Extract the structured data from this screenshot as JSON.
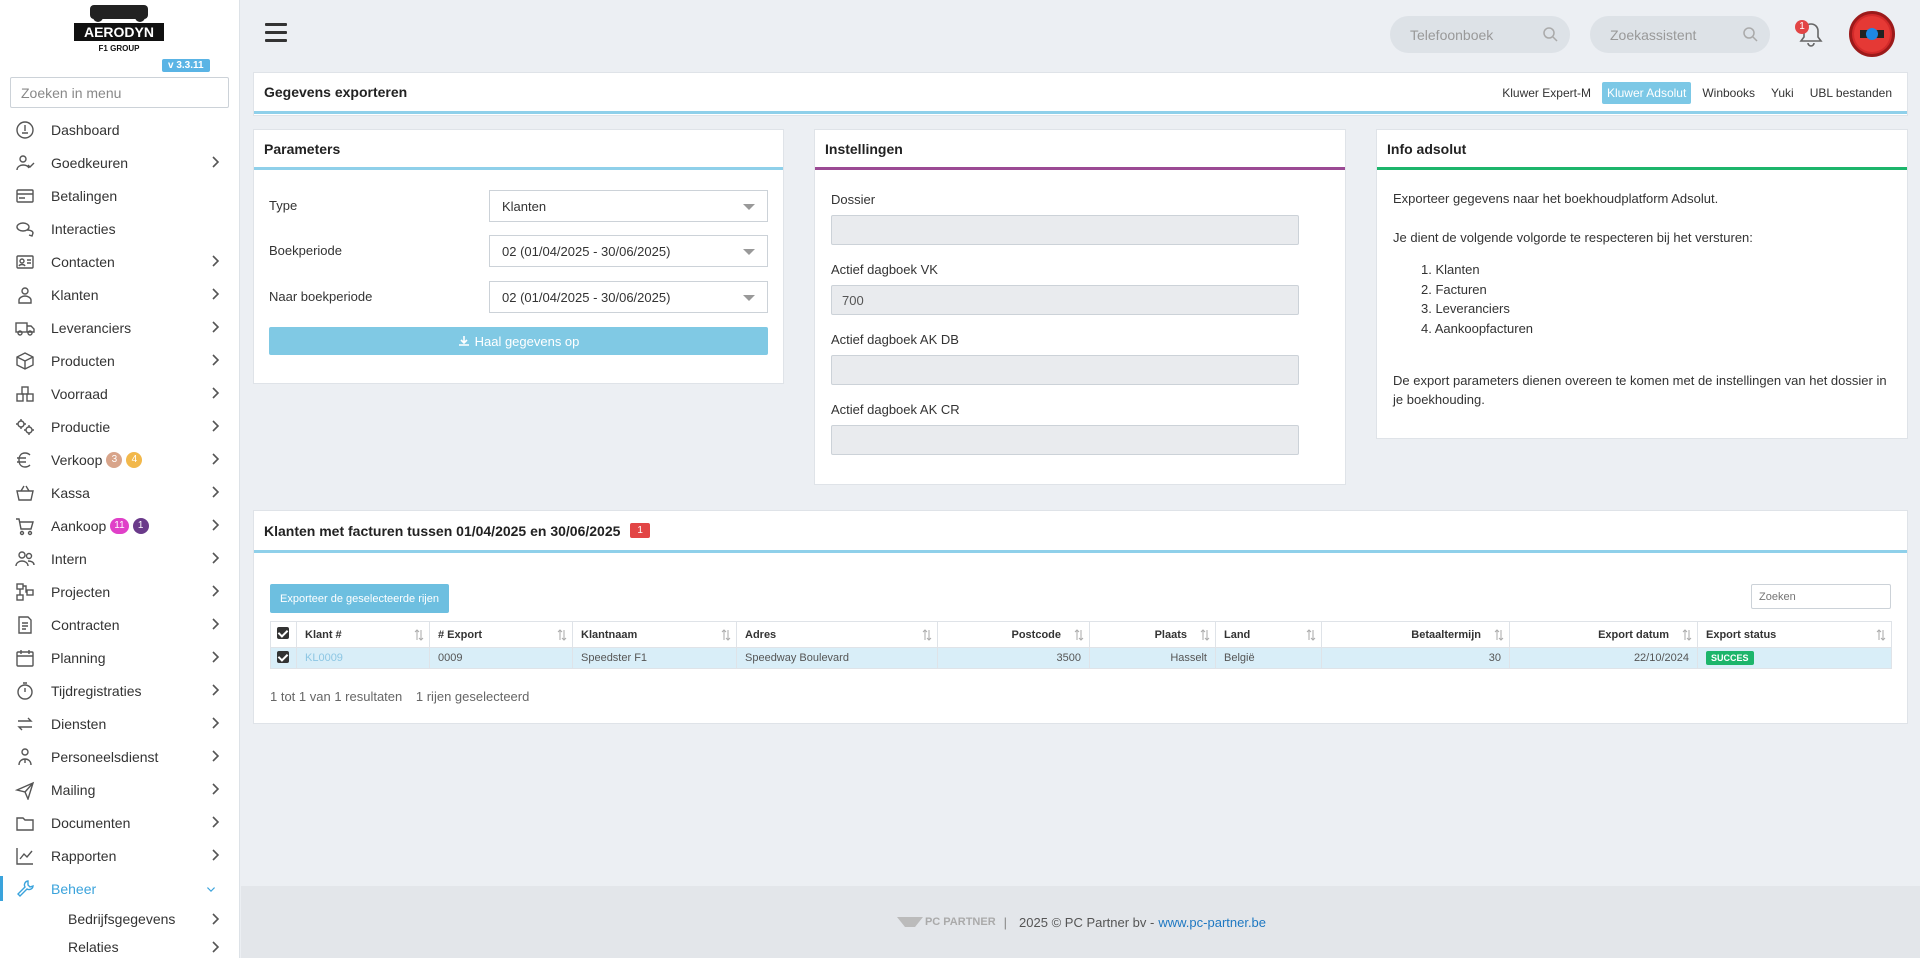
{
  "sidebar": {
    "logo_text": "AERODYN",
    "logo_sub": "F1 GROUP",
    "version": "v 3.3.11",
    "search_placeholder": "Zoeken in menu",
    "items": [
      {
        "label": "Dashboard",
        "icon": "dashboard-icon",
        "chevron": false
      },
      {
        "label": "Goedkeuren",
        "icon": "user-check-icon",
        "chevron": true
      },
      {
        "label": "Betalingen",
        "icon": "card-icon",
        "chevron": false
      },
      {
        "label": "Interacties",
        "icon": "chat-icon",
        "chevron": false
      },
      {
        "label": "Contacten",
        "icon": "contact-card-icon",
        "chevron": true
      },
      {
        "label": "Klanten",
        "icon": "customer-icon",
        "chevron": true
      },
      {
        "label": "Leveranciers",
        "icon": "truck-icon",
        "chevron": true
      },
      {
        "label": "Producten",
        "icon": "box-icon",
        "chevron": true
      },
      {
        "label": "Voorraad",
        "icon": "stock-icon",
        "chevron": true
      },
      {
        "label": "Productie",
        "icon": "gears-icon",
        "chevron": true
      },
      {
        "label": "Verkoop",
        "icon": "euro-icon",
        "chevron": true,
        "badges": [
          {
            "text": "3",
            "color": "#d8a48a"
          },
          {
            "text": "4",
            "color": "#f2b84b"
          }
        ]
      },
      {
        "label": "Kassa",
        "icon": "basket-icon",
        "chevron": true
      },
      {
        "label": "Aankoop",
        "icon": "cart-icon",
        "chevron": true,
        "badges": [
          {
            "text": "11",
            "color": "#e040c8"
          },
          {
            "text": "1",
            "color": "#6a3a8a"
          }
        ]
      },
      {
        "label": "Intern",
        "icon": "users-icon",
        "chevron": true
      },
      {
        "label": "Projecten",
        "icon": "project-icon",
        "chevron": true
      },
      {
        "label": "Contracten",
        "icon": "contract-icon",
        "chevron": true
      },
      {
        "label": "Planning",
        "icon": "calendar-icon",
        "chevron": true
      },
      {
        "label": "Tijdregistraties",
        "icon": "timer-icon",
        "chevron": true
      },
      {
        "label": "Diensten",
        "icon": "exchange-icon",
        "chevron": true
      },
      {
        "label": "Personeelsdienst",
        "icon": "staff-icon",
        "chevron": true
      },
      {
        "label": "Mailing",
        "icon": "send-icon",
        "chevron": true
      },
      {
        "label": "Documenten",
        "icon": "folder-icon",
        "chevron": true
      },
      {
        "label": "Rapporten",
        "icon": "chart-icon",
        "chevron": true
      },
      {
        "label": "Beheer",
        "icon": "wrench-icon",
        "chevron": true,
        "active": true
      }
    ],
    "sub_items": [
      "Bedrijfsgegevens",
      "Relaties"
    ]
  },
  "topbar": {
    "phonebook_placeholder": "Telefoonboek",
    "search_assistant_placeholder": "Zoekassistent",
    "notification_count": "1"
  },
  "export": {
    "title": "Gegevens exporteren",
    "tabs": [
      {
        "label": "Kluwer Expert-M",
        "active": false
      },
      {
        "label": "Kluwer Adsolut",
        "active": true
      },
      {
        "label": "Winbooks",
        "active": false
      },
      {
        "label": "Yuki",
        "active": false
      },
      {
        "label": "UBL bestanden",
        "active": false
      }
    ]
  },
  "parameters": {
    "title": "Parameters",
    "type_label": "Type",
    "type_value": "Klanten",
    "boekperiode_label": "Boekperiode",
    "boekperiode_value": "02 (01/04/2025 - 30/06/2025)",
    "naar_label": "Naar boekperiode",
    "naar_value": "02 (01/04/2025 - 30/06/2025)",
    "button": "Haal gegevens op"
  },
  "instellingen": {
    "title": "Instellingen",
    "dossier_label": "Dossier",
    "dossier_value": "",
    "vk_label": "Actief dagboek VK",
    "vk_value": "700",
    "akdb_label": "Actief dagboek AK DB",
    "akdb_value": "",
    "akcr_label": "Actief dagboek AK CR",
    "akcr_value": ""
  },
  "info": {
    "title": "Info adsolut",
    "intro": "Exporteer gegevens naar het boekhoudplatform Adsolut.",
    "order_text": "Je dient de volgende volgorde te respecteren bij het versturen:",
    "steps": [
      "1. Klanten",
      "2. Facturen",
      "3. Leveranciers",
      "4. Aankoopfacturen"
    ],
    "note": "De export parameters dienen overeen te komen met de instellingen van het dossier in je boekhouding."
  },
  "klanten": {
    "title": "Klanten met facturen tussen 01/04/2025 en 30/06/2025",
    "count": "1",
    "export_button": "Exporteer de geselecteerde rijen",
    "search_placeholder": "Zoeken",
    "columns": [
      "Klant #",
      "# Export",
      "Klantnaam",
      "Adres",
      "Postcode",
      "Plaats",
      "Land",
      "Betaaltermijn",
      "Export datum",
      "Export status"
    ],
    "rows": [
      {
        "klant": "KL0009",
        "export": "0009",
        "naam": "Speedster F1",
        "adres": "Speedway Boulevard",
        "postcode": "3500",
        "plaats": "Hasselt",
        "land": "België",
        "termijn": "30",
        "datum": "22/10/2024",
        "status": "SUCCES"
      }
    ],
    "results_text": "1 tot 1 van 1 resultaten",
    "selected_text": "1 rijen geselecteerd"
  },
  "footer": {
    "brand": "PC PARTNER",
    "separator": "|",
    "copyright": "2025 © PC Partner bv -",
    "link": "www.pc-partner.be"
  },
  "colors": {
    "accent": "#3aa3dc",
    "success": "#1cb56b",
    "danger": "#e24545"
  }
}
